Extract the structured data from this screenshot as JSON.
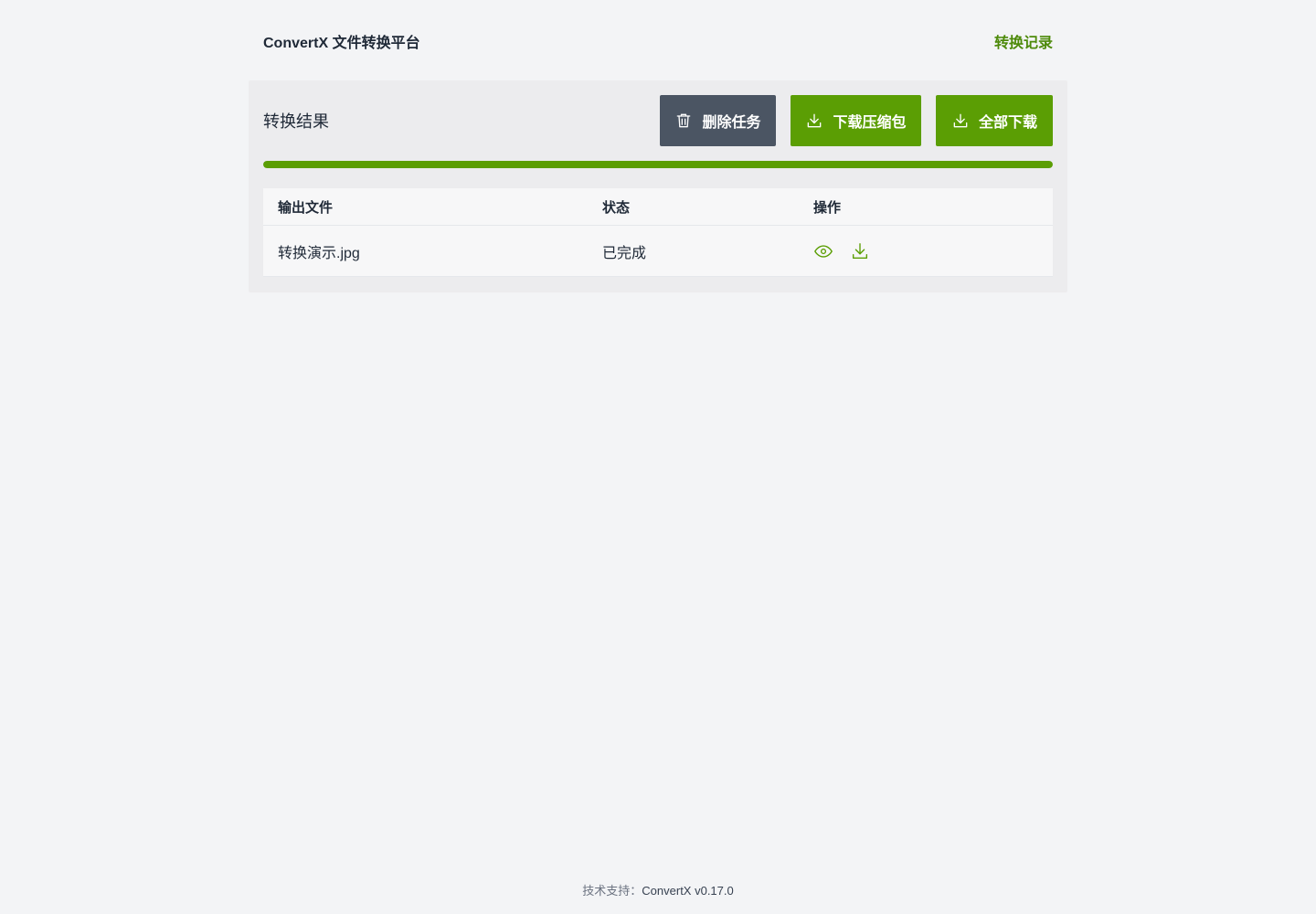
{
  "header": {
    "brand": "ConvertX 文件转换平台",
    "history_link": "转换记录"
  },
  "panel": {
    "title": "转换结果",
    "buttons": {
      "delete": "删除任务",
      "download_zip": "下载压缩包",
      "download_all": "全部下载"
    },
    "progress_percent": 100,
    "table": {
      "headers": [
        "输出文件",
        "状态",
        "操作"
      ],
      "rows": [
        {
          "file": "转换演示.jpg",
          "status": "已完成",
          "actions": [
            "eye-icon",
            "download-icon"
          ]
        }
      ]
    }
  },
  "footer": {
    "label": "技术支持：",
    "version": "ConvertX v0.17.0"
  },
  "colors": {
    "accent": "#5b9e04",
    "link": "#4d8a0a",
    "delete_button": "#4b5563",
    "page_bg": "#f3f4f6"
  }
}
